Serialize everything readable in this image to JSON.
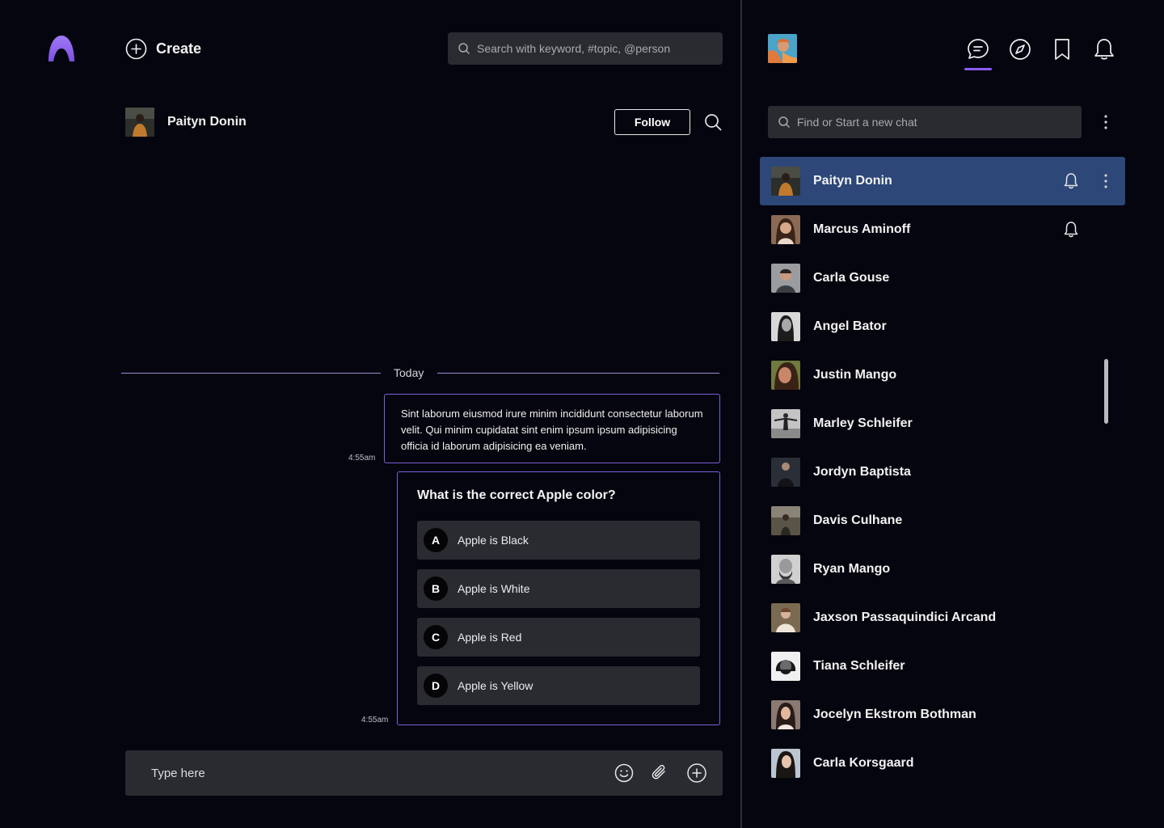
{
  "header": {
    "create_label": "Create",
    "search_placeholder": "Search with keyword, #topic, @person"
  },
  "conversation": {
    "name": "Paityn Donin",
    "follow_label": "Follow",
    "divider_label": "Today",
    "messages": [
      {
        "text": "Sint laborum eiusmod irure minim incididunt consectetur laborum velit. Qui minim cupidatat sint enim ipsum ipsum adipisicing officia id laborum adipisicing ea veniam.",
        "time": "4:55am"
      }
    ],
    "poll": {
      "question": "What is the correct Apple color?",
      "time": "4:55am",
      "options": [
        {
          "letter": "A",
          "text": "Apple is Black"
        },
        {
          "letter": "B",
          "text": "Apple is White"
        },
        {
          "letter": "C",
          "text": "Apple is Red"
        },
        {
          "letter": "D",
          "text": "Apple is Yellow"
        }
      ]
    },
    "composer_placeholder": "Type here"
  },
  "sidebar": {
    "nav_icons": [
      "chat-icon",
      "compass-icon",
      "bookmark-icon",
      "bell-icon"
    ],
    "active_nav": "chat-icon",
    "search_placeholder": "Find or Start a new chat",
    "chats": [
      {
        "name": "Paityn Donin",
        "active": true,
        "pinned_bell": true
      },
      {
        "name": "Marcus Aminoff",
        "active": false,
        "pinned_bell": true
      },
      {
        "name": "Carla Gouse",
        "active": false,
        "pinned_bell": false
      },
      {
        "name": "Angel Bator",
        "active": false,
        "pinned_bell": false
      },
      {
        "name": "Justin Mango",
        "active": false,
        "pinned_bell": false
      },
      {
        "name": "Marley Schleifer",
        "active": false,
        "pinned_bell": false
      },
      {
        "name": "Jordyn Baptista",
        "active": false,
        "pinned_bell": false
      },
      {
        "name": "Davis Culhane",
        "active": false,
        "pinned_bell": false
      },
      {
        "name": "Ryan Mango",
        "active": false,
        "pinned_bell": false
      },
      {
        "name": "Jaxson Passaquindici Arcand",
        "active": false,
        "pinned_bell": false
      },
      {
        "name": "Tiana Schleifer",
        "active": false,
        "pinned_bell": false
      },
      {
        "name": "Jocelyn Ekstrom Bothman",
        "active": false,
        "pinned_bell": false
      },
      {
        "name": "Carla Korsgaard",
        "active": false,
        "pinned_bell": false
      }
    ]
  },
  "colors": {
    "accent": "#8a5cf6",
    "active_row": "#2c4778",
    "bubble_border": "#7a62d6",
    "input_bg": "#2a2b31",
    "background": "#05050f"
  }
}
